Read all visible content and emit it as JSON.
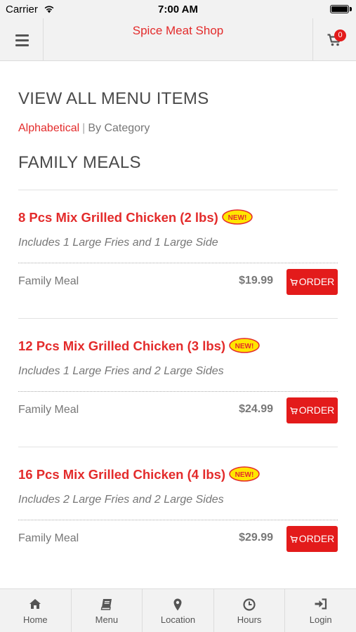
{
  "status_bar": {
    "carrier": "Carrier",
    "time": "7:00 AM"
  },
  "header": {
    "shop_name": "Spice Meat Shop",
    "cart_count": "0"
  },
  "page": {
    "title": "VIEW ALL MENU ITEMS",
    "sort_options": {
      "alphabetical": "Alphabetical",
      "separator": "|",
      "by_category": "By Category"
    },
    "category": "FAMILY MEALS"
  },
  "items": [
    {
      "name": "8 Pcs Mix Grilled Chicken (2 lbs)",
      "badge": "NEW!",
      "description": "Includes 1 Large Fries and 1 Large Side",
      "type": "Family Meal",
      "price": "$19.99",
      "order_label": "ORDER"
    },
    {
      "name": "12 Pcs Mix Grilled Chicken (3 lbs)",
      "badge": "NEW!",
      "description": "Includes 1 Large Fries and 2 Large Sides",
      "type": "Family Meal",
      "price": "$24.99",
      "order_label": "ORDER"
    },
    {
      "name": "16 Pcs Mix Grilled Chicken (4 lbs)",
      "badge": "NEW!",
      "description": "Includes 2 Large Fries and 2 Large Sides",
      "type": "Family Meal",
      "price": "$29.99",
      "order_label": "ORDER"
    }
  ],
  "tabbar": {
    "home": "Home",
    "menu": "Menu",
    "location": "Location",
    "hours": "Hours",
    "login": "Login"
  },
  "colors": {
    "accent": "#e32b2b",
    "button": "#e31b1b",
    "badge_fill": "#ffe600",
    "bar_bg": "#f2f2f2"
  },
  "icons": [
    "wifi-icon",
    "battery-icon",
    "hamburger-icon",
    "cart-icon",
    "new-badge-icon",
    "home-icon",
    "book-icon",
    "map-marker-icon",
    "clock-icon",
    "login-icon"
  ]
}
